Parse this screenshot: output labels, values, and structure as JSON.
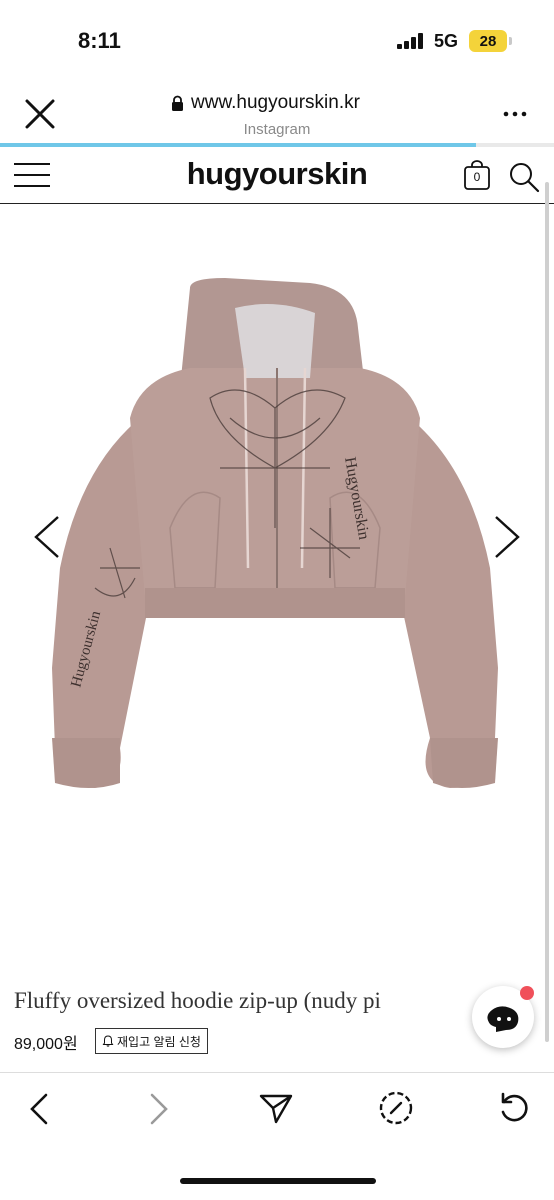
{
  "status_bar": {
    "time": "8:11",
    "network": "5G",
    "battery": "28"
  },
  "browser": {
    "url": "www.hugyourskin.kr",
    "source": "Instagram",
    "load_progress": 0.86
  },
  "site": {
    "logo": "hugyourskin",
    "cart_count": "0"
  },
  "product": {
    "title": "Fluffy oversized hoodie zip-up (nudy pi",
    "price": "89,000원",
    "notify_label": "재입고 알림 신청",
    "image_color": "#b89a94"
  },
  "icons": {
    "close": "close-icon",
    "lock": "lock-icon",
    "more": "more-icon",
    "menu": "menu-icon",
    "cart": "cart-icon",
    "search": "search-icon",
    "prev": "chevron-left-icon",
    "next": "chevron-right-icon",
    "bell": "bell-icon",
    "chat": "chat-icon",
    "back": "back-icon",
    "forward": "forward-icon",
    "share": "share-icon",
    "safari": "compass-icon",
    "reload": "reload-icon"
  }
}
